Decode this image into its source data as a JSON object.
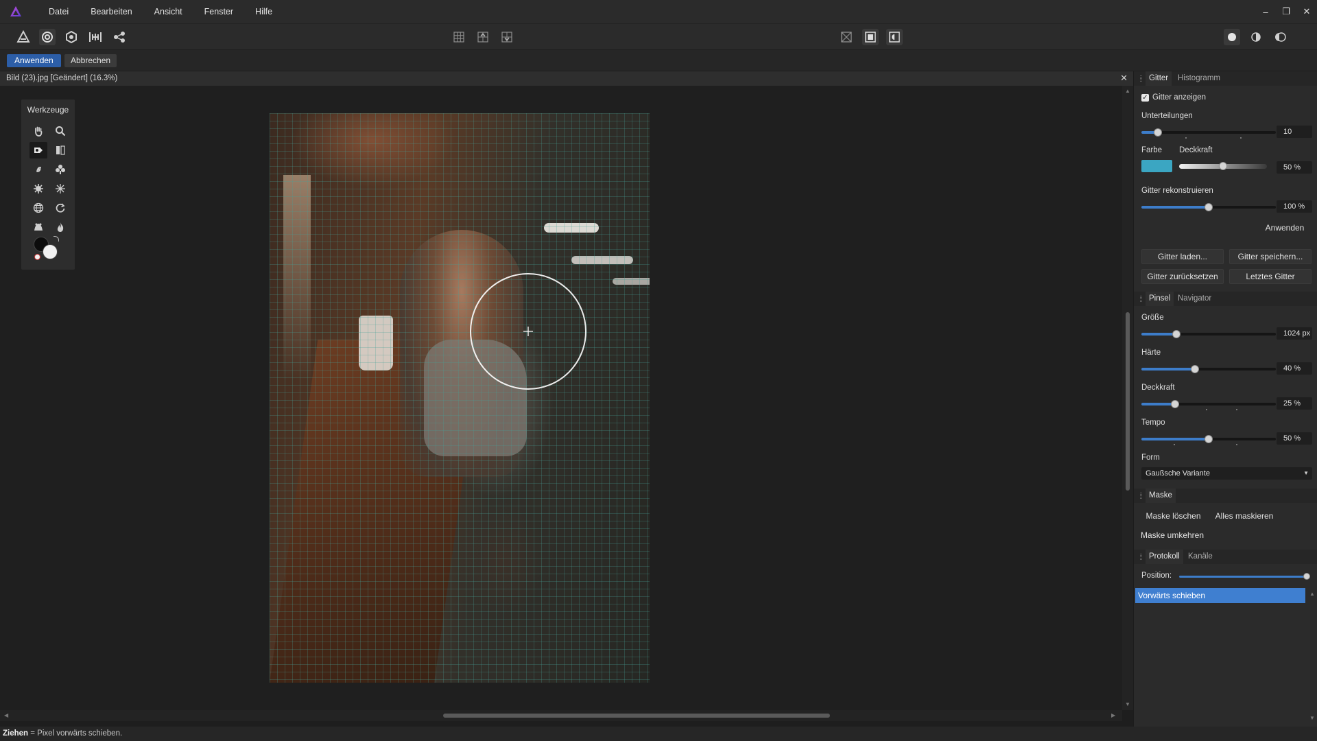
{
  "colors": {
    "accent": "#3d7dca",
    "apply_button": "#2c5ea8",
    "grid_color": "#3ba6c2",
    "history_selected": "#3f7fd0"
  },
  "menubar": {
    "items": [
      "Datei",
      "Bearbeiten",
      "Ansicht",
      "Fenster",
      "Hilfe"
    ],
    "window_controls": {
      "minimize": "‒",
      "restore": "❐",
      "close": "✕"
    }
  },
  "contextbar": {
    "apply_label": "Anwenden",
    "cancel_label": "Abbrechen"
  },
  "document": {
    "title": "Bild (23).jpg [Geändert] (16.3%)",
    "close_glyph": "✕"
  },
  "tools": {
    "title": "Werkzeuge",
    "items": [
      "hand-icon",
      "zoom-icon",
      "forward-warp-icon",
      "freeze-icon",
      "twirl-icon",
      "pinch-icon",
      "punch-icon",
      "turbulence-icon",
      "globe-icon",
      "reconstruct-icon",
      "hood-icon",
      "fire-icon"
    ]
  },
  "grid_panel": {
    "tabs": [
      "Gitter",
      "Histogramm"
    ],
    "show_grid_label": "Gitter anzeigen",
    "show_grid_checked": true,
    "subdivisions_label": "Unterteilungen",
    "subdivisions_value": "10",
    "subdivisions_fraction": 0.12,
    "color_label": "Farbe",
    "opacity_label": "Deckkraft",
    "opacity_value": "50 %",
    "opacity_fraction": 0.5,
    "reconstruct_label": "Gitter rekonstruieren",
    "reconstruct_value": "100 %",
    "reconstruct_fraction": 0.5,
    "apply_label": "Anwenden",
    "load_label": "Gitter laden...",
    "save_label": "Gitter speichern...",
    "reset_label": "Gitter zurücksetzen",
    "last_label": "Letztes Gitter"
  },
  "brush_panel": {
    "tabs": [
      "Pinsel",
      "Navigator"
    ],
    "size_label": "Größe",
    "size_value": "1024 px",
    "size_fraction": 0.26,
    "hardness_label": "Härte",
    "hardness_value": "40 %",
    "hardness_fraction": 0.4,
    "opacity_label": "Deckkraft",
    "opacity_value": "25 %",
    "opacity_fraction": 0.25,
    "speed_label": "Tempo",
    "speed_value": "50 %",
    "speed_fraction": 0.5,
    "shape_label": "Form",
    "shape_value": "Gaußsche Variante"
  },
  "mask_panel": {
    "title": "Maske",
    "clear_label": "Maske löschen",
    "mask_all_label": "Alles maskieren",
    "invert_label": "Maske umkehren"
  },
  "history_panel": {
    "tabs": [
      "Protokoll",
      "Kanäle"
    ],
    "position_label": "Position:",
    "position_fraction": 1.0,
    "items": [
      "Vorwärts schieben"
    ]
  },
  "status": {
    "action": "Ziehen",
    "description": " = Pixel vorwärts schieben."
  }
}
